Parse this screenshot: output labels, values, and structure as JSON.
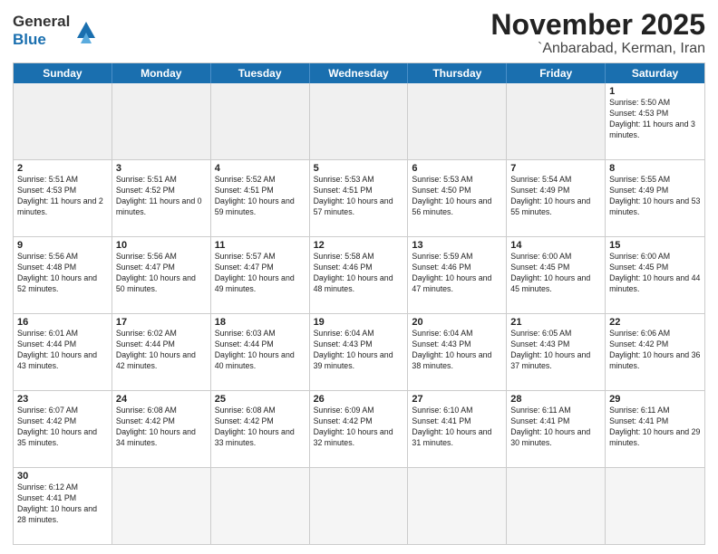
{
  "header": {
    "logo_general": "General",
    "logo_blue": "Blue",
    "month": "November 2025",
    "location": "`Anbarabad, Kerman, Iran"
  },
  "weekdays": [
    "Sunday",
    "Monday",
    "Tuesday",
    "Wednesday",
    "Thursday",
    "Friday",
    "Saturday"
  ],
  "weeks": [
    [
      {
        "day": "",
        "empty": true
      },
      {
        "day": "",
        "empty": true
      },
      {
        "day": "",
        "empty": true
      },
      {
        "day": "",
        "empty": true
      },
      {
        "day": "",
        "empty": true
      },
      {
        "day": "",
        "empty": true
      },
      {
        "day": "1",
        "sunrise": "Sunrise: 5:50 AM",
        "sunset": "Sunset: 4:53 PM",
        "daylight": "Daylight: 11 hours and 3 minutes."
      }
    ],
    [
      {
        "day": "2",
        "sunrise": "Sunrise: 5:51 AM",
        "sunset": "Sunset: 4:53 PM",
        "daylight": "Daylight: 11 hours and 2 minutes."
      },
      {
        "day": "3",
        "sunrise": "Sunrise: 5:51 AM",
        "sunset": "Sunset: 4:52 PM",
        "daylight": "Daylight: 11 hours and 0 minutes."
      },
      {
        "day": "4",
        "sunrise": "Sunrise: 5:52 AM",
        "sunset": "Sunset: 4:51 PM",
        "daylight": "Daylight: 10 hours and 59 minutes."
      },
      {
        "day": "5",
        "sunrise": "Sunrise: 5:53 AM",
        "sunset": "Sunset: 4:51 PM",
        "daylight": "Daylight: 10 hours and 57 minutes."
      },
      {
        "day": "6",
        "sunrise": "Sunrise: 5:53 AM",
        "sunset": "Sunset: 4:50 PM",
        "daylight": "Daylight: 10 hours and 56 minutes."
      },
      {
        "day": "7",
        "sunrise": "Sunrise: 5:54 AM",
        "sunset": "Sunset: 4:49 PM",
        "daylight": "Daylight: 10 hours and 55 minutes."
      },
      {
        "day": "8",
        "sunrise": "Sunrise: 5:55 AM",
        "sunset": "Sunset: 4:49 PM",
        "daylight": "Daylight: 10 hours and 53 minutes."
      }
    ],
    [
      {
        "day": "9",
        "sunrise": "Sunrise: 5:56 AM",
        "sunset": "Sunset: 4:48 PM",
        "daylight": "Daylight: 10 hours and 52 minutes."
      },
      {
        "day": "10",
        "sunrise": "Sunrise: 5:56 AM",
        "sunset": "Sunset: 4:47 PM",
        "daylight": "Daylight: 10 hours and 50 minutes."
      },
      {
        "day": "11",
        "sunrise": "Sunrise: 5:57 AM",
        "sunset": "Sunset: 4:47 PM",
        "daylight": "Daylight: 10 hours and 49 minutes."
      },
      {
        "day": "12",
        "sunrise": "Sunrise: 5:58 AM",
        "sunset": "Sunset: 4:46 PM",
        "daylight": "Daylight: 10 hours and 48 minutes."
      },
      {
        "day": "13",
        "sunrise": "Sunrise: 5:59 AM",
        "sunset": "Sunset: 4:46 PM",
        "daylight": "Daylight: 10 hours and 47 minutes."
      },
      {
        "day": "14",
        "sunrise": "Sunrise: 6:00 AM",
        "sunset": "Sunset: 4:45 PM",
        "daylight": "Daylight: 10 hours and 45 minutes."
      },
      {
        "day": "15",
        "sunrise": "Sunrise: 6:00 AM",
        "sunset": "Sunset: 4:45 PM",
        "daylight": "Daylight: 10 hours and 44 minutes."
      }
    ],
    [
      {
        "day": "16",
        "sunrise": "Sunrise: 6:01 AM",
        "sunset": "Sunset: 4:44 PM",
        "daylight": "Daylight: 10 hours and 43 minutes."
      },
      {
        "day": "17",
        "sunrise": "Sunrise: 6:02 AM",
        "sunset": "Sunset: 4:44 PM",
        "daylight": "Daylight: 10 hours and 42 minutes."
      },
      {
        "day": "18",
        "sunrise": "Sunrise: 6:03 AM",
        "sunset": "Sunset: 4:44 PM",
        "daylight": "Daylight: 10 hours and 40 minutes."
      },
      {
        "day": "19",
        "sunrise": "Sunrise: 6:04 AM",
        "sunset": "Sunset: 4:43 PM",
        "daylight": "Daylight: 10 hours and 39 minutes."
      },
      {
        "day": "20",
        "sunrise": "Sunrise: 6:04 AM",
        "sunset": "Sunset: 4:43 PM",
        "daylight": "Daylight: 10 hours and 38 minutes."
      },
      {
        "day": "21",
        "sunrise": "Sunrise: 6:05 AM",
        "sunset": "Sunset: 4:43 PM",
        "daylight": "Daylight: 10 hours and 37 minutes."
      },
      {
        "day": "22",
        "sunrise": "Sunrise: 6:06 AM",
        "sunset": "Sunset: 4:42 PM",
        "daylight": "Daylight: 10 hours and 36 minutes."
      }
    ],
    [
      {
        "day": "23",
        "sunrise": "Sunrise: 6:07 AM",
        "sunset": "Sunset: 4:42 PM",
        "daylight": "Daylight: 10 hours and 35 minutes."
      },
      {
        "day": "24",
        "sunrise": "Sunrise: 6:08 AM",
        "sunset": "Sunset: 4:42 PM",
        "daylight": "Daylight: 10 hours and 34 minutes."
      },
      {
        "day": "25",
        "sunrise": "Sunrise: 6:08 AM",
        "sunset": "Sunset: 4:42 PM",
        "daylight": "Daylight: 10 hours and 33 minutes."
      },
      {
        "day": "26",
        "sunrise": "Sunrise: 6:09 AM",
        "sunset": "Sunset: 4:42 PM",
        "daylight": "Daylight: 10 hours and 32 minutes."
      },
      {
        "day": "27",
        "sunrise": "Sunrise: 6:10 AM",
        "sunset": "Sunset: 4:41 PM",
        "daylight": "Daylight: 10 hours and 31 minutes."
      },
      {
        "day": "28",
        "sunrise": "Sunrise: 6:11 AM",
        "sunset": "Sunset: 4:41 PM",
        "daylight": "Daylight: 10 hours and 30 minutes."
      },
      {
        "day": "29",
        "sunrise": "Sunrise: 6:11 AM",
        "sunset": "Sunset: 4:41 PM",
        "daylight": "Daylight: 10 hours and 29 minutes."
      }
    ],
    [
      {
        "day": "30",
        "sunrise": "Sunrise: 6:12 AM",
        "sunset": "Sunset: 4:41 PM",
        "daylight": "Daylight: 10 hours and 28 minutes."
      },
      {
        "day": "",
        "empty": true
      },
      {
        "day": "",
        "empty": true
      },
      {
        "day": "",
        "empty": true
      },
      {
        "day": "",
        "empty": true
      },
      {
        "day": "",
        "empty": true
      },
      {
        "day": "",
        "empty": true
      }
    ]
  ]
}
